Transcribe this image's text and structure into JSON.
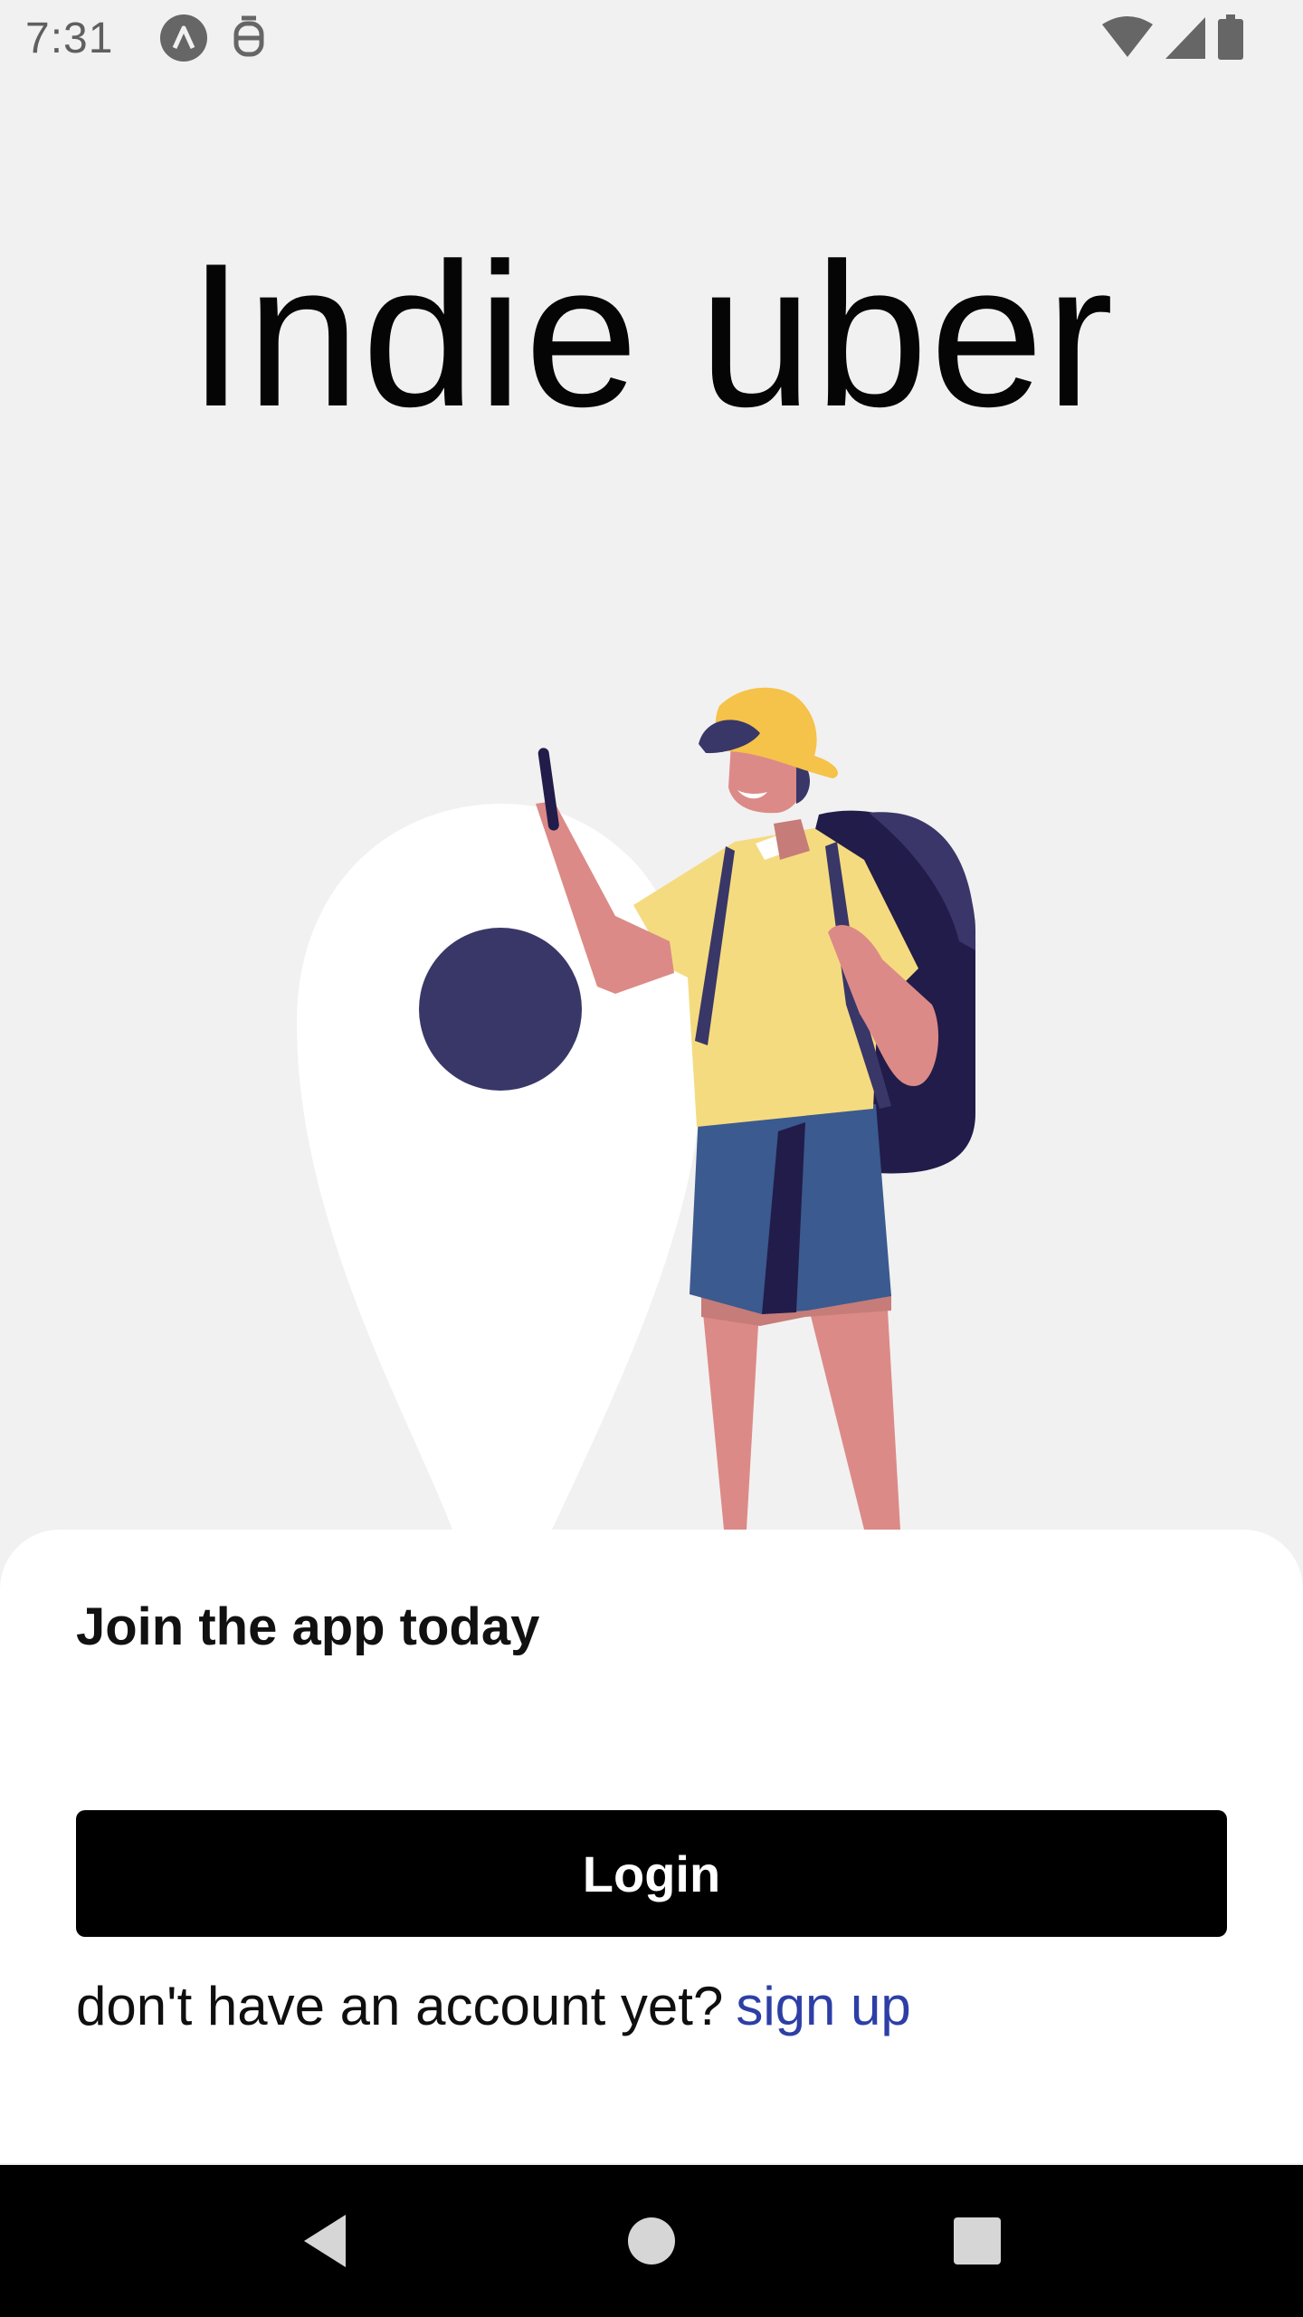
{
  "status_bar": {
    "time": "7:31",
    "left_icons": [
      "app-notification-icon",
      "accessibility-icon"
    ],
    "right_icons": [
      "wifi-icon",
      "signal-icon",
      "battery-icon"
    ]
  },
  "app": {
    "title": "Indie uber"
  },
  "illustration": {
    "name": "traveler-with-location-pin"
  },
  "sheet": {
    "title": "Join the app today",
    "login_label": "Login",
    "signup_prompt": "don't have an account yet?",
    "signup_link": "sign up"
  },
  "nav_bar": {
    "buttons": [
      "back-icon",
      "home-icon",
      "recents-icon"
    ]
  },
  "colors": {
    "background": "#f2f1f1",
    "sheet": "#ffffff",
    "button": "#000000",
    "link": "#2d3fa6",
    "pin_dot": "#393767",
    "shirt": "#f5db80",
    "shorts": "#3b5a8f",
    "skin": "#dc8a87",
    "backpack": "#221c4a"
  }
}
